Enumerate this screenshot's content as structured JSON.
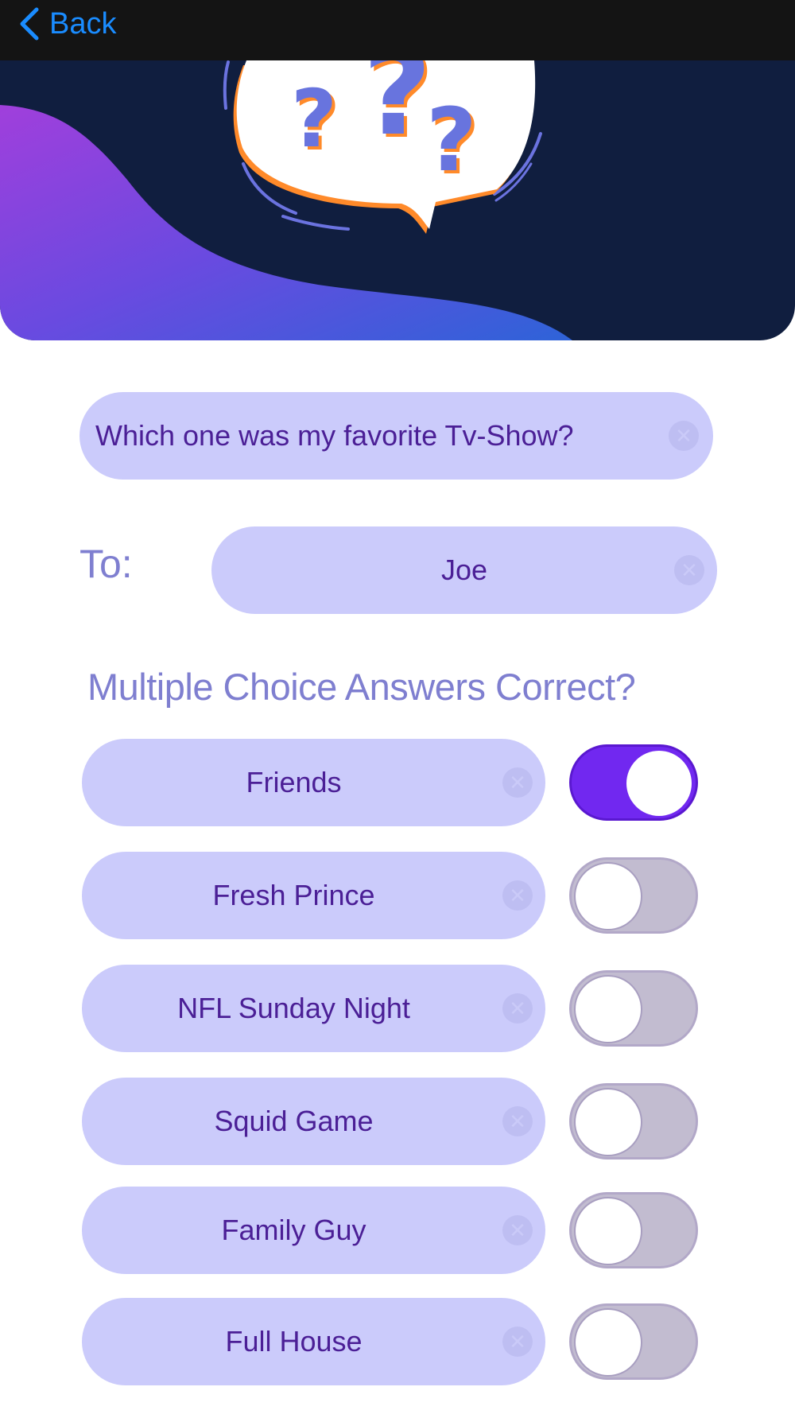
{
  "nav": {
    "back_label": "Back"
  },
  "question": {
    "value": "Which one was my favorite Tv-Show?"
  },
  "recipient": {
    "label": "To:",
    "value": "Joe"
  },
  "answers_section": {
    "header": "Multiple Choice Answers Correct?"
  },
  "answers": [
    {
      "label": "Friends",
      "correct": true
    },
    {
      "label": "Fresh Prince",
      "correct": false
    },
    {
      "label": "NFL Sunday Night",
      "correct": false
    },
    {
      "label": "Squid Game",
      "correct": false
    },
    {
      "label": "Family Guy",
      "correct": false
    },
    {
      "label": "Full House",
      "correct": false
    }
  ],
  "colors": {
    "accent": "#1a8cff",
    "toggle_on": "#7128f0",
    "pill_background": "#cbcbfb",
    "text": "#4b1f96"
  },
  "icons": {
    "back": "chevron-left-icon",
    "clear": "clear-circle-icon",
    "hero": "question-marks-speech-bubble"
  }
}
